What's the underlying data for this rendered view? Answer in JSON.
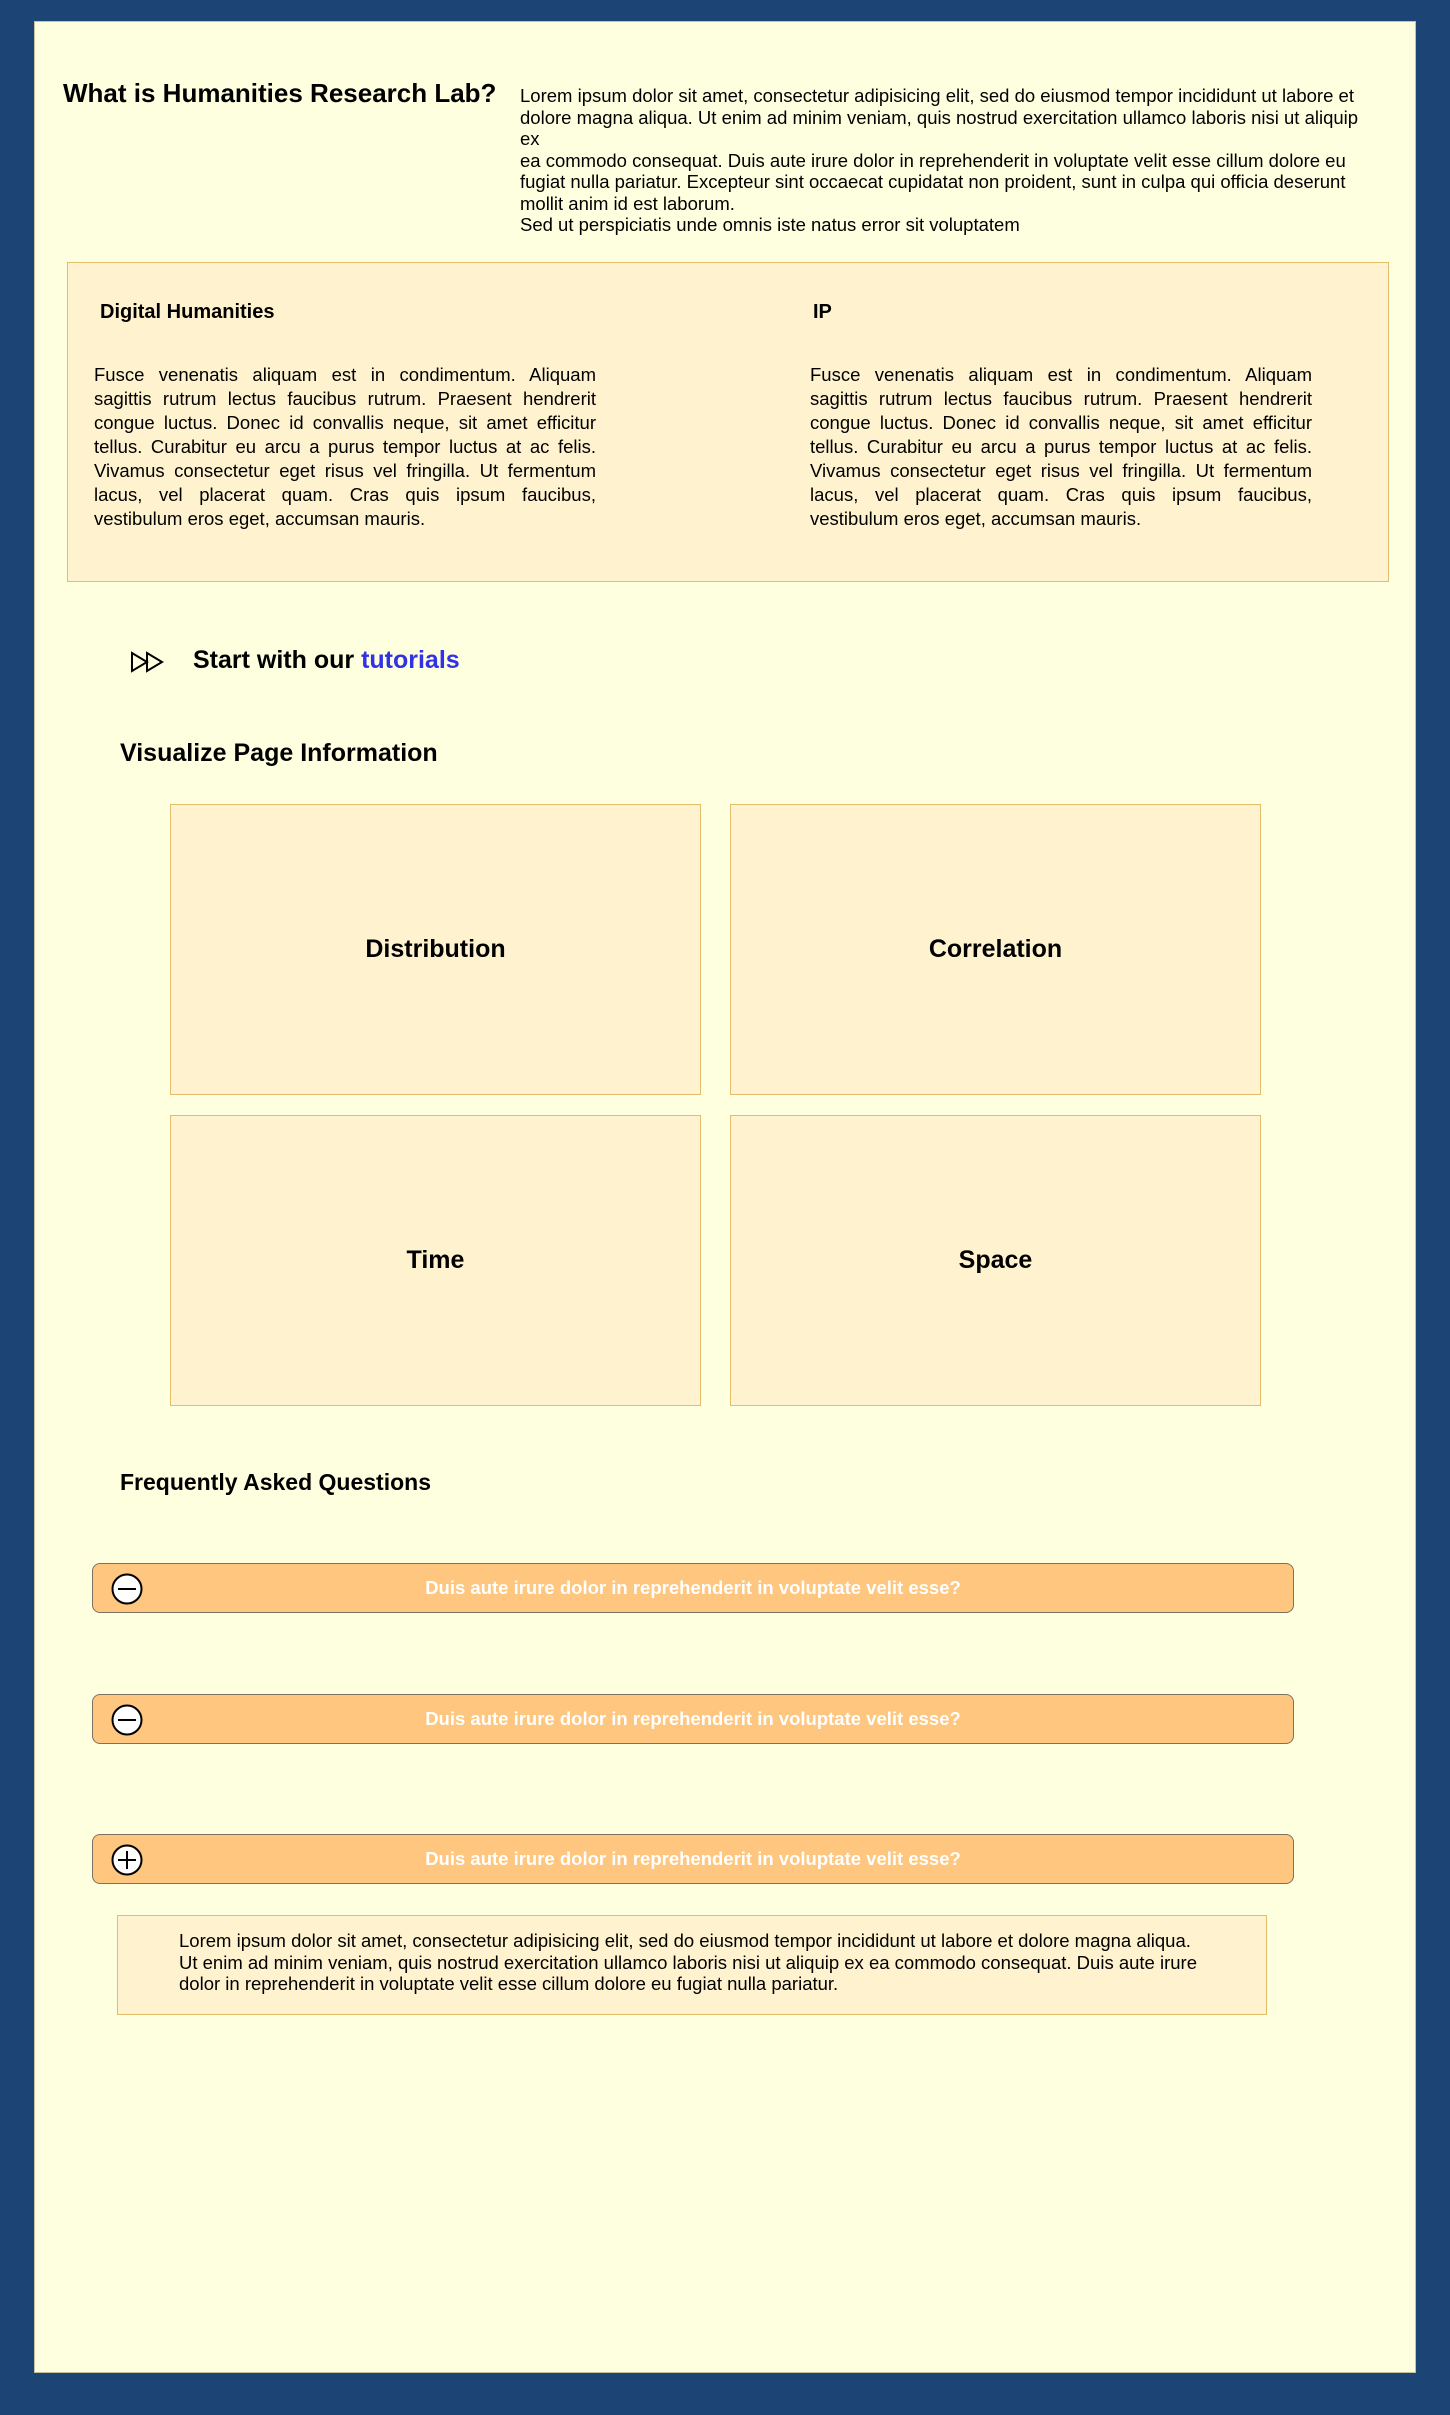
{
  "intro": {
    "title": "What is Humanities Research Lab?",
    "lines": [
      "Lorem ipsum dolor sit amet, consectetur adipisicing elit, sed do eiusmod tempor incididunt ut labore et",
      "dolore magna aliqua. Ut enim ad minim veniam, quis nostrud exercitation ullamco laboris nisi ut aliquip ex",
      "ea commodo consequat. Duis aute irure dolor in reprehenderit in voluptate velit esse cillum dolore eu",
      "fugiat nulla pariatur. Excepteur sint occaecat cupidatat non proident, sunt in culpa qui officia deserunt",
      "mollit anim id est laborum.",
      "Sed ut perspiciatis unde omnis iste natus error sit voluptatem"
    ]
  },
  "info": {
    "columns": [
      {
        "title": "Digital Humanities",
        "text": "Fusce venenatis aliquam est in condimentum. Aliquam sagittis rutrum lectus faucibus rutrum. Praesent hendrerit congue luctus. Donec id convallis neque, sit amet efficitur tellus. Curabitur eu arcu a purus tempor luctus at ac felis. Vivamus consectetur eget risus vel fringilla. Ut fermentum lacus, vel placerat quam. Cras quis ipsum faucibus, vestibulum eros eget, accumsan mauris."
      },
      {
        "title": "IP",
        "text": "Fusce venenatis aliquam est in condimentum. Aliquam sagittis rutrum lectus faucibus rutrum. Praesent hendrerit congue luctus. Donec id convallis neque, sit amet efficitur tellus. Curabitur eu arcu a purus tempor luctus at ac felis. Vivamus consectetur eget risus vel fringilla. Ut fermentum lacus, vel placerat quam. Cras quis ipsum faucibus, vestibulum eros eget, accumsan mauris."
      }
    ]
  },
  "tutorial": {
    "icon": "fast-forward-icon",
    "prefix": "Start with our ",
    "link_label": "tutorials"
  },
  "visualize": {
    "title": "Visualize Page Information",
    "cards": [
      "Distribution",
      "Correlation",
      "Time",
      "Space"
    ]
  },
  "faq": {
    "title": "Frequently Asked Questions",
    "items": [
      {
        "question": "Duis aute irure dolor in reprehenderit in voluptate velit esse?",
        "icon": "minus-circle-icon"
      },
      {
        "question": "Duis aute irure dolor in reprehenderit in voluptate velit esse?",
        "icon": "minus-circle-icon"
      },
      {
        "question": "Duis aute irure dolor in reprehenderit in voluptate velit esse?",
        "icon": "plus-circle-icon"
      }
    ],
    "answer": "Lorem ipsum dolor sit amet, consectetur adipisicing elit, sed do eiusmod tempor incididunt ut labore et dolore magna aliqua. Ut enim ad minim veniam, quis nostrud exercitation ullamco laboris nisi ut aliquip ex ea commodo consequat. Duis aute irure dolor in reprehenderit in voluptate velit esse cillum dolore eu fugiat nulla pariatur."
  },
  "colors": {
    "frame": "#1c4576",
    "page": "#feffdf",
    "panel": "#fff2cf",
    "panel_border": "#e3bd6b",
    "faq_bar": "#fec67e",
    "link": "#3131e6"
  }
}
